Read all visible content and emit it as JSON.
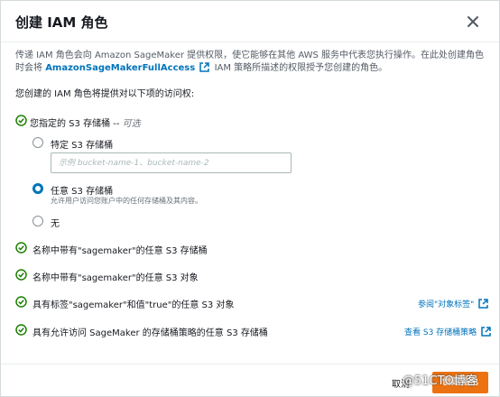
{
  "dialog": {
    "title": "创建 IAM 角色",
    "description_part1": "传递 IAM 角色会向 Amazon SageMaker 提供权限，使它能够在其他 AWS 服务中代表您执行操作。在此处创建角色时会将",
    "policy_link": "AmazonSageMakerFullAccess",
    "description_part2": "IAM 策略所描述的权限授予您创建的角色。",
    "access_heading": "您创建的 IAM 角色将提供对以下项的访问权:"
  },
  "s3_section": {
    "label": "您指定的 S3 存储桶",
    "separator": "--",
    "optional": "可选",
    "options": [
      {
        "label": "特定 S3 存储桶",
        "selected": false
      },
      {
        "label": "任意 S3 存储桶",
        "selected": true,
        "description": "允许用户访问您账户中的任何存储桶及其内容。"
      },
      {
        "label": "无",
        "selected": false
      }
    ],
    "bucket_placeholder": "示例 bucket-name-1、bucket-name-2"
  },
  "permissions": [
    {
      "label": "名称中带有\"sagemaker\"的任意 S3 存储桶"
    },
    {
      "label": "名称中带有\"sagemaker\"的任意 S3 对象"
    },
    {
      "label": "具有标签\"sagemaker\"和值\"true\"的任意 S3 对象",
      "link": "参阅\"对象标签\""
    },
    {
      "label": "具有允许访问 SageMaker 的存储桶策略的任意 S3 存储桶",
      "link": "查看 S3 存储桶策略"
    }
  ],
  "footer": {
    "cancel_label": "取消",
    "create_label": "创建角色"
  },
  "watermark": "@51CTO博客",
  "colors": {
    "check_green": "#1d8102",
    "link_blue": "#0073bb",
    "primary_orange": "#ec7211",
    "radio_selected": "#0073bb"
  }
}
